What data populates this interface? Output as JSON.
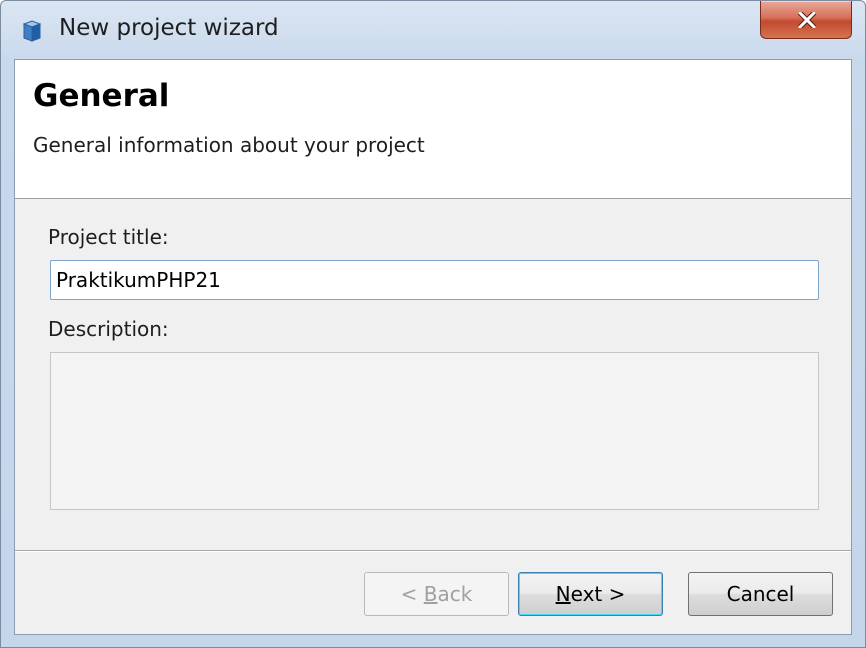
{
  "window": {
    "title": "New project wizard",
    "icon": "app-cube-icon",
    "close_symbol": "close-icon"
  },
  "header": {
    "title": "General",
    "subtitle": "General information about your project"
  },
  "form": {
    "title_label": "Project title:",
    "title_value": "PraktikumPHP21",
    "description_label": "Description:",
    "description_value": ""
  },
  "buttons": {
    "back": {
      "prefix": "< ",
      "mnemonic": "B",
      "rest": "ack",
      "enabled": false
    },
    "next": {
      "mnemonic": "N",
      "rest": "ext >",
      "enabled": true,
      "default": true
    },
    "cancel": {
      "label": "Cancel",
      "enabled": true
    }
  },
  "colors": {
    "close_button": "#c24a30",
    "default_button_border": "#3c7fb1",
    "window_frame": "#c9d9ec"
  }
}
